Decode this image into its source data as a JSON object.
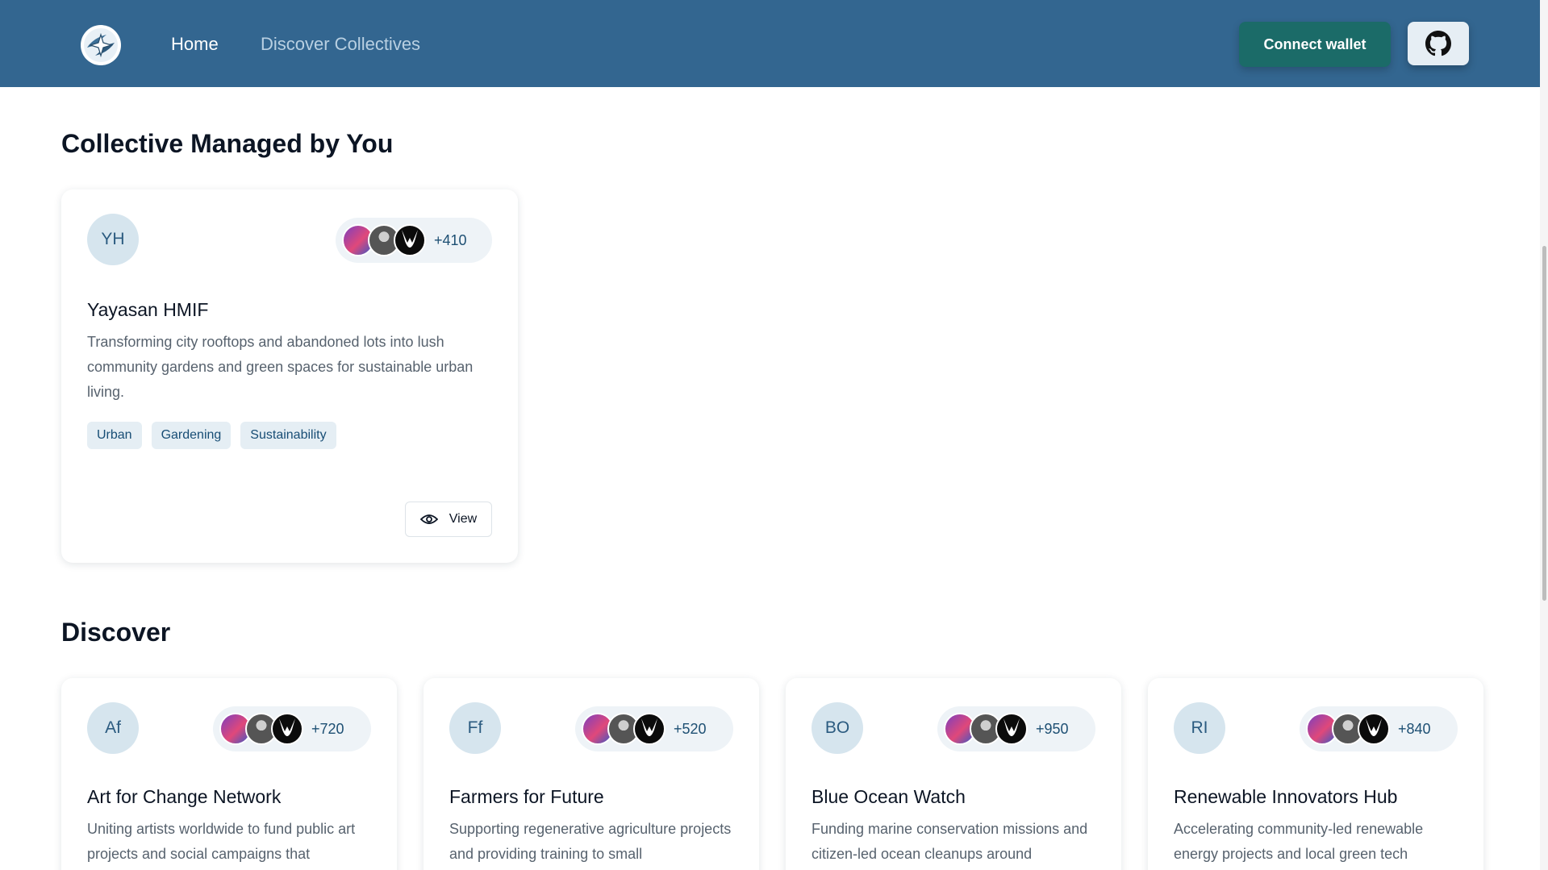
{
  "navbar": {
    "logo_icon": "star-compass-icon",
    "links": [
      {
        "label": "Home"
      },
      {
        "label": "Discover Collectives"
      }
    ],
    "connect_label": "Connect wallet",
    "github_icon": "github-icon",
    "colors": {
      "bar": "#336690",
      "connect": "#1b6b68"
    }
  },
  "managed": {
    "title": "Collective Managed by You",
    "card": {
      "initials": "YH",
      "member_count": "+410",
      "name": "Yayasan HMIF",
      "description": "Transforming city rooftops and abandoned lots into lush community gardens and green spaces for sustainable urban living.",
      "tags": [
        "Urban",
        "Gardening",
        "Sustainability"
      ],
      "view_label": "View"
    }
  },
  "discover": {
    "title": "Discover",
    "cards": [
      {
        "initials": "Af",
        "member_count": "+720",
        "name": "Art for Change Network",
        "description": "Uniting artists worldwide to fund public art projects and social campaigns that"
      },
      {
        "initials": "Ff",
        "member_count": "+520",
        "name": "Farmers for Future",
        "description": "Supporting regenerative agriculture projects and providing training to small"
      },
      {
        "initials": "BO",
        "member_count": "+950",
        "name": "Blue Ocean Watch",
        "description": "Funding marine conservation missions and citizen-led ocean cleanups around"
      },
      {
        "initials": "RI",
        "member_count": "+840",
        "name": "Renewable Innovators Hub",
        "description": "Accelerating community-led renewable energy projects and local green tech"
      }
    ]
  }
}
